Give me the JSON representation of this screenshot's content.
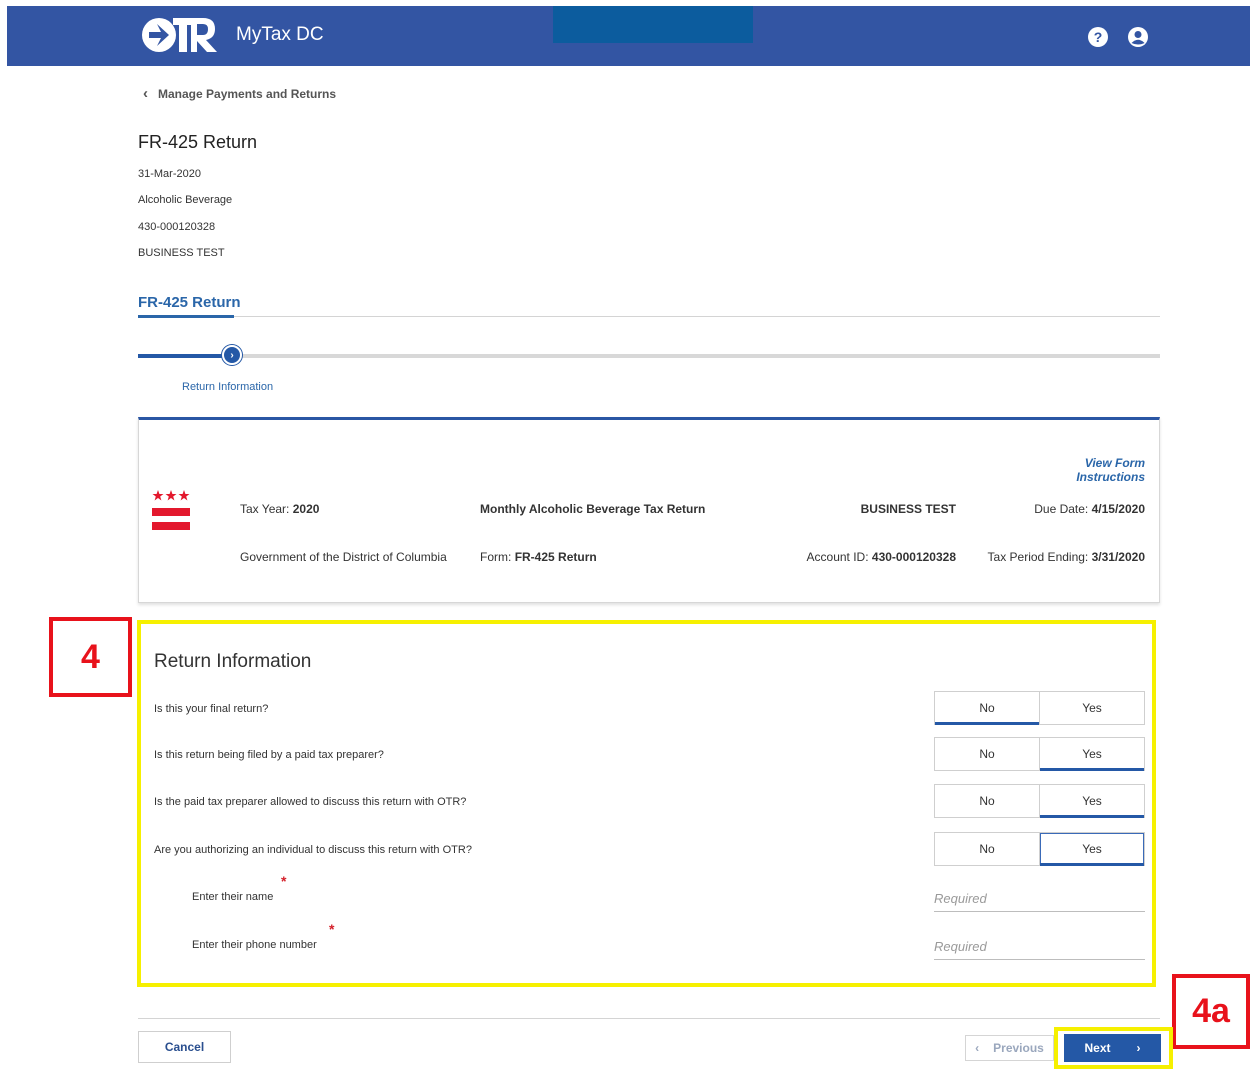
{
  "header": {
    "logo_text": "OTR",
    "brand": "MyTax DC",
    "icons": [
      "help-icon",
      "user-icon"
    ],
    "bar_color": "#3355a3"
  },
  "back_link": {
    "label": "Manage Payments and Returns",
    "icon": "chevron-left-icon"
  },
  "return_header": {
    "title": "FR-425 Return",
    "period": "31-Mar-2020",
    "tax_type": "Alcoholic Beverage",
    "account": "430-000120328",
    "business": "BUSINESS TEST"
  },
  "section_tab": {
    "label": "FR-425 Return"
  },
  "stepper": {
    "steps": [
      {
        "label": "Return Information",
        "icon": "chevron-right-icon",
        "active": true
      }
    ]
  },
  "info_card": {
    "view_instructions": "View Form Instructions",
    "tax_year_label": "Tax Year:",
    "tax_year": "2020",
    "government": "Government of the District of Columbia",
    "return_name": "Monthly Alcoholic Beverage Tax Return",
    "form_label": "Form:",
    "form": "FR-425 Return",
    "business": "BUSINESS TEST",
    "account_label": "Account ID:",
    "account": "430-000120328",
    "due_label": "Due Date:",
    "due": "4/15/2020",
    "period_label": "Tax Period Ending:",
    "period": "3/31/2020",
    "flag_icon": "dc-flag-icon"
  },
  "form": {
    "heading": "Return Information",
    "questions": [
      {
        "label": "Is this your final return?",
        "no": "No",
        "yes": "Yes",
        "selected": "No"
      },
      {
        "label": "Is this return being filed by a paid tax preparer?",
        "no": "No",
        "yes": "Yes",
        "selected": "Yes"
      },
      {
        "label": "Is the paid tax preparer allowed to discuss this return with OTR?",
        "no": "No",
        "yes": "Yes",
        "selected": "Yes"
      },
      {
        "label": "Are you authorizing an individual to discuss this return with OTR?",
        "no": "No",
        "yes": "Yes",
        "selected": "Yes"
      }
    ],
    "name_field": {
      "label": "Enter their name",
      "placeholder": "Required",
      "required_mark": "*"
    },
    "phone_field": {
      "label": "Enter their phone number",
      "placeholder": "Required",
      "required_mark": "*"
    }
  },
  "callouts": {
    "main": "4",
    "next": "4a"
  },
  "footer": {
    "cancel": "Cancel",
    "previous": "Previous",
    "next": "Next"
  },
  "colors": {
    "accent": "#2458a6",
    "highlight": "#f6f000",
    "callout": "#e8121b"
  }
}
